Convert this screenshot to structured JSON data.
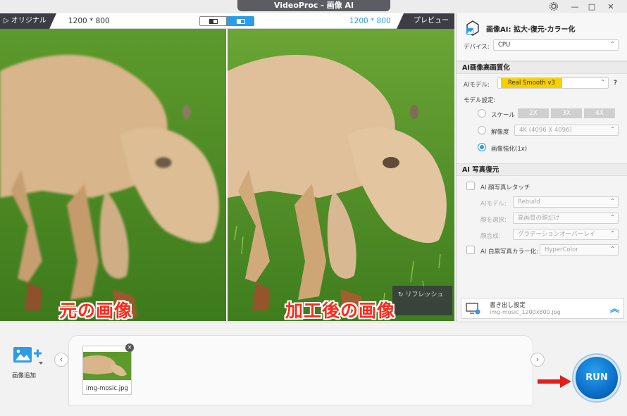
{
  "window": {
    "title": "VideoProc - 画像 AI",
    "minimize": "—",
    "maximize": "□",
    "close": "✕"
  },
  "toolbar": {
    "original_label": "▷ オリジナル",
    "left_resolution": "1200 * 800",
    "right_resolution": "1200 * 800",
    "preview_label": "プレビュー"
  },
  "panes": {
    "left_overlay": "元の画像",
    "right_overlay": "加工後の画像",
    "refresh_label": "リフレッシュ"
  },
  "panel": {
    "title": "画像AI: 拡大·復元·カラー化",
    "device_label": "デバイス:",
    "device_value": "CPU",
    "section_enhance": "AI画像高画質化",
    "ai_model_label": "AIモデル:",
    "ai_model_value": "Real Smooth v3",
    "help": "?",
    "model_settings_label": "モデル設定:",
    "scale_label": "スケール",
    "scale_options": [
      "2X",
      "3X",
      "4X"
    ],
    "resolution_label": "解像度",
    "resolution_value": "4K (4096 X 4096)",
    "enhance_label": "画像強化(1x)",
    "section_restore": "AI 写真復元",
    "face_retouch_label": "AI 顔写真レタッチ",
    "face_model_label": "AIモデル:",
    "face_model_value": "Rebuild",
    "face_select_label": "顔を選択:",
    "face_select_value": "高画質の顔だけ",
    "face_merge_label": "顔合成:",
    "face_merge_value": "グラデーションオーバーレイ",
    "colorize_label": "AI 白黒写真カラー化:",
    "colorize_value": "HyperColor",
    "export_title": "書き出し設定",
    "export_file": "img-mosic_1200x800.jpg"
  },
  "bottom": {
    "add_image_label": "画像追加",
    "thumb_caption": "img-mosic.jpg",
    "run_label": "RUN"
  },
  "colors": {
    "accent": "#2d9ce6",
    "model_highlight": "#f6d000",
    "overlay_text": "#ff2a1a",
    "arrow": "#e0201b"
  }
}
